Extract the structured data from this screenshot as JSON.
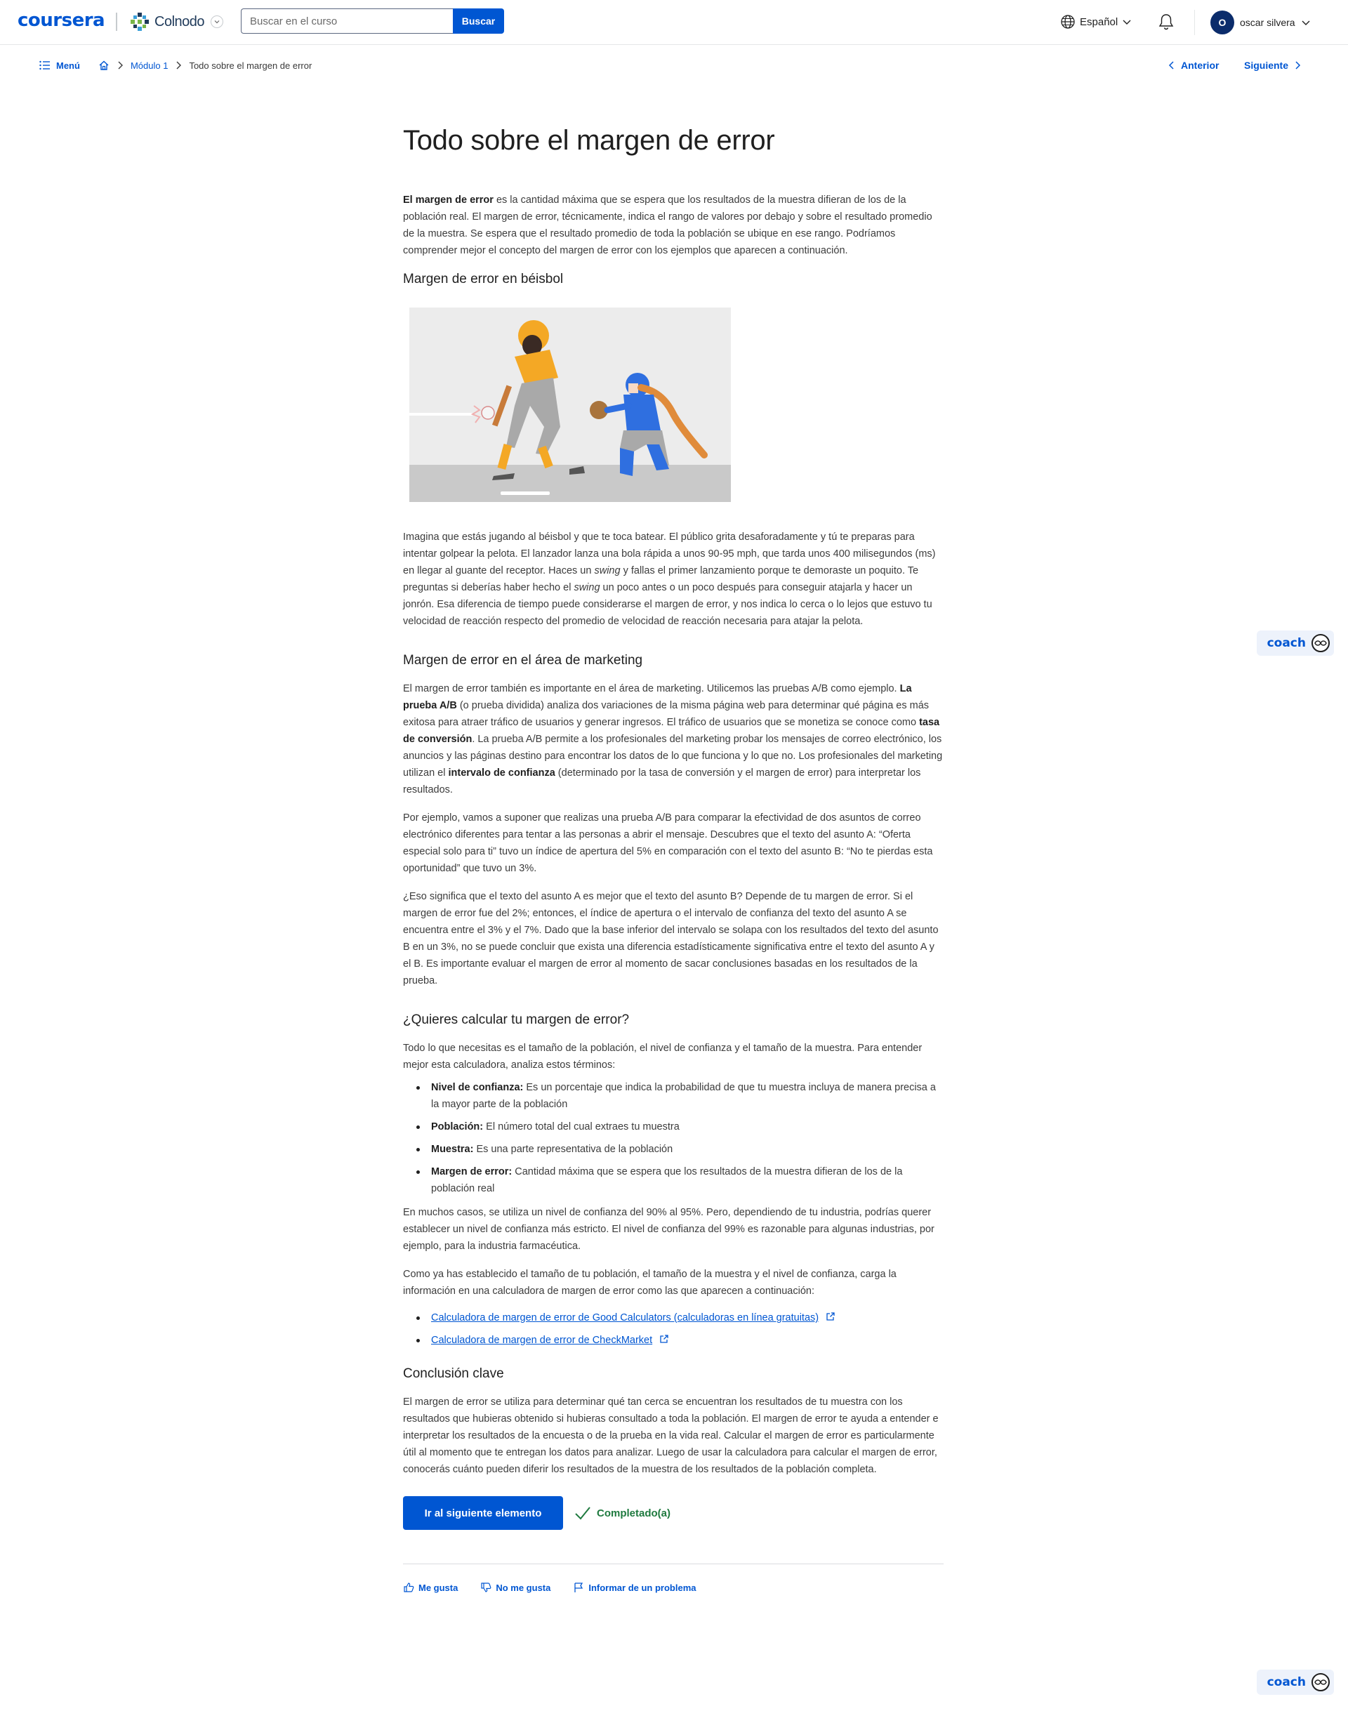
{
  "header": {
    "logo": "coursera",
    "partner": "Colnodo",
    "search": {
      "placeholder": "Buscar en el curso",
      "button": "Buscar"
    },
    "language": "Español",
    "user": {
      "initial": "O",
      "name": "oscar silvera"
    }
  },
  "breadcrumb": {
    "menu": "Menú",
    "module": "Módulo 1",
    "current": "Todo sobre el margen de error"
  },
  "pager": {
    "prev": "Anterior",
    "next": "Siguiente"
  },
  "article": {
    "title": "Todo sobre el margen de error",
    "intro": {
      "bold": "El margen de error",
      "text": " es la cantidad máxima que se espera que los resultados de la muestra difieran de los de la población real. El margen de error, técnicamente, indica el rango de valores por debajo y sobre el resultado promedio de la muestra. Se espera que el resultado promedio de toda la población se ubique en ese rango. Podríamos comprender mejor el concepto del margen de error con los ejemplos que aparecen a continuación."
    },
    "baseball": {
      "heading": "Margen de error en béisbol",
      "p_a": "Imagina que estás jugando al béisbol y que te toca batear. El público grita desaforadamente y tú te preparas para intentar golpear la pelota. El lanzador lanza una bola rápida a unos 90-95 mph, que tarda unos 400 milisegundos (ms) en llegar al guante del receptor. Haces un ",
      "swing1": "swing",
      "p_b": " y fallas el primer lanzamiento porque te demoraste un poquito. Te preguntas si deberías haber hecho el ",
      "swing2": "swing",
      "p_c": " un poco antes o un poco después para conseguir atajarla y hacer un jonrón. Esa diferencia de tiempo puede considerarse el margen de error, y nos indica lo cerca o lo lejos que estuvo tu velocidad de reacción respecto del promedio de velocidad de reacción necesaria para atajar la pelota."
    },
    "marketing": {
      "heading": "Margen de error en el área de marketing",
      "p1_a": "El margen de error también es importante en el área de marketing. Utilicemos las pruebas A/B como ejemplo. ",
      "p1_b1": "La prueba A/B",
      "p1_c": " (o prueba dividida) analiza dos variaciones de la misma página web para determinar qué página es más exitosa para atraer tráfico de usuarios y generar ingresos. El tráfico de usuarios que se monetiza se conoce como ",
      "p1_b2": "tasa de conversión",
      "p1_d": ". La prueba A/B permite a los profesionales del marketing probar los mensajes de correo electrónico, los anuncios y las páginas destino para encontrar los datos de lo que funciona y lo que no. Los profesionales del marketing utilizan el ",
      "p1_b3": "intervalo de confianza",
      "p1_e": " (determinado por la tasa de conversión y el margen de error) para interpretar los resultados.",
      "p2": "Por ejemplo, vamos a suponer que realizas una prueba A/B para comparar la efectividad de dos asuntos de correo electrónico diferentes para tentar a las personas a abrir el mensaje. Descubres que el texto del asunto A: “Oferta especial solo para ti” tuvo un índice de apertura del 5% en comparación con el texto del asunto B: “No te pierdas esta oportunidad” que tuvo un 3%.",
      "p3": "¿Eso significa que el texto del asunto A es mejor que el texto del asunto B? Depende de tu margen de error. Si el margen de error fue del 2%; entonces, el índice de apertura o el intervalo de confianza del texto del asunto A se encuentra entre el 3% y el 7%. Dado que la base inferior del intervalo se solapa con los resultados del texto del asunto B en un 3%, no se puede concluir que exista una diferencia estadísticamente significativa entre el texto del asunto A y el B. Es importante evaluar el margen de error al momento de sacar conclusiones basadas en los resultados de la prueba."
    },
    "calc": {
      "heading": "¿Quieres calcular tu margen de error?",
      "p1": "Todo lo que necesitas es el tamaño de la población, el nivel de confianza y el tamaño de la muestra. Para entender mejor esta calculadora, analiza estos términos:",
      "terms": [
        {
          "term": "Nivel de confianza:",
          "desc": " Es un porcentaje que indica la probabilidad de que tu muestra incluya de manera precisa a la mayor parte de la población"
        },
        {
          "term": "Población:",
          "desc": " El número total del cual extraes tu muestra"
        },
        {
          "term": "Muestra:",
          "desc": " Es una parte representativa de la población"
        },
        {
          "term": "Margen de error:",
          "desc": " Cantidad máxima que se espera que los resultados de la muestra difieran de los de la población real"
        }
      ],
      "p2": "En muchos casos, se utiliza un nivel de confianza del 90% al 95%. Pero, dependiendo de tu industria, podrías querer establecer un nivel de confianza más estricto. El nivel de confianza del 99% es razonable para algunas industrias, por ejemplo, para la industria farmacéutica.",
      "p3": "Como ya has establecido el tamaño de tu población, el tamaño de la muestra y el nivel de confianza, carga la información en una calculadora de margen de error como las que aparecen a continuación:",
      "links": [
        "Calculadora de margen de error de Good Calculators (calculadoras en línea gratuitas)",
        "Calculadora de margen de error de CheckMarket"
      ]
    },
    "conclusion": {
      "heading": "Conclusión clave",
      "p": "El margen de error se utiliza para determinar qué tan cerca se encuentran los resultados de tu muestra con los resultados que hubieras obtenido si hubieras consultado a toda la población. El margen de error te ayuda a entender e interpretar los resultados de la encuesta o de la prueba en la vida real.  Calcular el margen de error es particularmente útil al momento que te entregan los datos para analizar. Luego de usar la calculadora para calcular el margen de error, conocerás cuánto pueden diferir los resultados de la muestra de los resultados de la población completa."
    }
  },
  "actions": {
    "next_item": "Ir al siguiente elemento",
    "completed": "Completado(a)",
    "like": "Me gusta",
    "dislike": "No me gusta",
    "report": "Informar de un problema"
  },
  "coach": {
    "label": "coach"
  },
  "colors": {
    "accent": "#0056d2",
    "success": "#1f7a3f",
    "bat_jersey": "#f4a825",
    "catcher_jersey": "#2f6fe0"
  }
}
